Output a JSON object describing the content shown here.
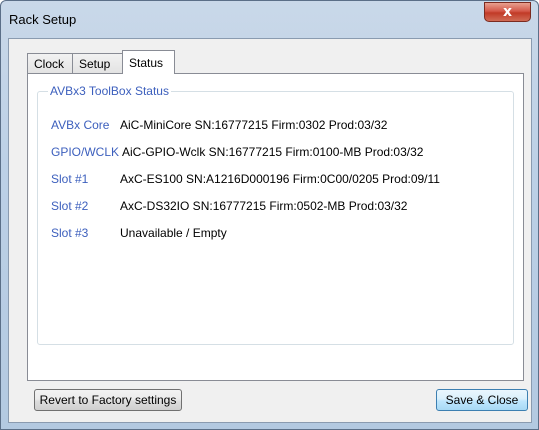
{
  "window": {
    "title": "Rack Setup",
    "close_label": "x"
  },
  "tabs": [
    {
      "label": "Clock"
    },
    {
      "label": "Setup"
    },
    {
      "label": "Status"
    }
  ],
  "group": {
    "title": "AVBx3 ToolBox Status"
  },
  "rows": [
    {
      "label": "AVBx Core",
      "value": "AiC-MiniCore SN:16777215 Firm:0302 Prod:03/32"
    },
    {
      "label": "GPIO/WCLK",
      "value": "AiC-GPIO-Wclk SN:16777215 Firm:0100-MB Prod:03/32"
    },
    {
      "label": "Slot #1",
      "value": "AxC-ES100 SN:A1216D000196 Firm:0C00/0205 Prod:09/11"
    },
    {
      "label": "Slot #2",
      "value": "AxC-DS32IO SN:16777215 Firm:0502-MB Prod:03/32"
    },
    {
      "label": "Slot #3",
      "value": "Unavailable / Empty"
    }
  ],
  "buttons": {
    "revert": "Revert to Factory settings",
    "save": "Save & Close"
  },
  "colors": {
    "accent": "#3c5fbd"
  }
}
